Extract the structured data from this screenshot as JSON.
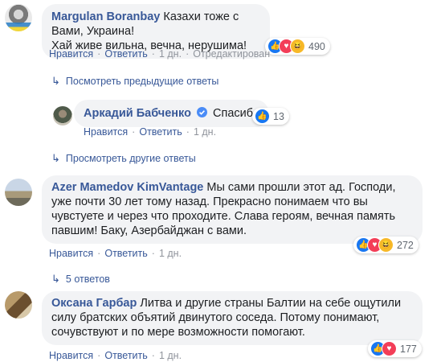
{
  "comments": [
    {
      "author": "Margulan Boranbay",
      "lines": [
        "Казахи тоже с Вами, Украина!",
        "Хай живе вильна, вечна, нерушима!"
      ],
      "actions": {
        "like": "Нравится",
        "reply": "Ответить",
        "time": "1 дн.",
        "edited": "Отредактирован"
      },
      "reactions": {
        "types": [
          "like",
          "love",
          "haha"
        ],
        "count": "490"
      },
      "more_link": "Посмотреть предыдущие ответы"
    },
    {
      "author": "Аркадий Бабченко",
      "verified": true,
      "text": "Спасибо",
      "actions": {
        "like": "Нравится",
        "reply": "Ответить",
        "time": "1 дн."
      },
      "reactions": {
        "types": [
          "like"
        ],
        "count": "13"
      },
      "more_link": "Просмотреть другие ответы"
    },
    {
      "author": "Azer Mamedov KimVantage",
      "lines": [
        "Мы сами прошли этот ад. Господи,",
        "уже почти 30 лет тому назад. Прекрасно понимаем что вы",
        "чувстуете и через что проходите. Слава героям, вечная память",
        "павшим! Баку, Азербайджан с вами."
      ],
      "actions": {
        "like": "Нравится",
        "reply": "Ответить",
        "time": "1 дн."
      },
      "reactions": {
        "types": [
          "like",
          "love",
          "haha"
        ],
        "count": "272"
      },
      "more_link": "5 ответов"
    },
    {
      "author": "Оксана Гарбар",
      "lines": [
        "Литва и другие страны Балтии на себе ощутили",
        "силу братских объятий двинутого соседа. Потому понимают,",
        "сочувствуют и по мере возможности помогают."
      ],
      "actions": {
        "like": "Нравится",
        "reply": "Ответить",
        "time": "1 дн."
      },
      "reactions": {
        "types": [
          "like",
          "love"
        ],
        "count": "177"
      }
    }
  ],
  "colors": {
    "link": "#385898",
    "bubble": "#f2f3f5",
    "muted": "#90949c",
    "like": "#1877f2",
    "love": "#f33e58",
    "haha": "#f7b928"
  }
}
